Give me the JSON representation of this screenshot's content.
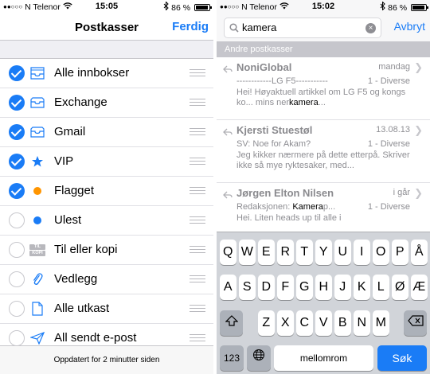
{
  "left": {
    "status": {
      "carrier": "N Telenor",
      "signal_dots": "●●○○○",
      "time": "15:05",
      "battery": "86 %",
      "battery_level": 0.86
    },
    "nav": {
      "title": "Postkasser",
      "done": "Ferdig"
    },
    "mailboxes": [
      {
        "label": "Alle innbokser",
        "checked": true,
        "icon": "tray-stack-icon"
      },
      {
        "label": "Exchange",
        "checked": true,
        "icon": "inbox-tray-icon"
      },
      {
        "label": "Gmail",
        "checked": true,
        "icon": "inbox-tray-icon"
      },
      {
        "label": "VIP",
        "checked": true,
        "icon": "star-icon"
      },
      {
        "label": "Flagget",
        "checked": true,
        "icon": "orange-dot-icon"
      },
      {
        "label": "Ulest",
        "checked": false,
        "icon": "blue-dot-icon"
      },
      {
        "label": "Til eller kopi",
        "checked": false,
        "icon": "to-cc-icon",
        "icon_text_top": "TIL",
        "icon_text_bottom": "KOPI"
      },
      {
        "label": "Vedlegg",
        "checked": false,
        "icon": "paperclip-icon"
      },
      {
        "label": "Alle utkast",
        "checked": false,
        "icon": "document-icon"
      },
      {
        "label": "All sendt e-post",
        "checked": false,
        "icon": "paper-plane-icon"
      }
    ],
    "footer": "Oppdatert for 2 minutter siden"
  },
  "right": {
    "status": {
      "carrier": "N Telenor",
      "signal_dots": "●●○○○",
      "time": "15:02",
      "battery": "86 %",
      "battery_level": 0.86
    },
    "search": {
      "value": "kamera",
      "cancel": "Avbryt"
    },
    "section_header": "Andre postkasser",
    "messages": [
      {
        "sender": "NoniGlobal",
        "date": "mandag",
        "subject": "------------LG F5-----------",
        "folder": "1 - Diverse",
        "preview_before": "Hei! Høyaktuell artikkel om LG F5 og kongs ko... mins ner",
        "preview_match": "kamera",
        "preview_after": "..."
      },
      {
        "sender": "Kjersti Stuestøl",
        "date": "13.08.13",
        "subject": "SV: Noe for Akam?",
        "folder": "1 - Diverse",
        "preview_before": "Jeg kikker nærmere på dette etterpå. Skriver ikke så mye ryktesaker, med...",
        "preview_match": "",
        "preview_after": ""
      },
      {
        "sender": "Jørgen Elton Nilsen",
        "date": "i går",
        "subject_before": "Redaksjonen: ",
        "subject_match": "Kamera",
        "subject_after": "p...",
        "folder": "1 - Diverse",
        "preview_before": "Hei. Liten heads up til alle i",
        "preview_match": "",
        "preview_after": ""
      }
    ],
    "keyboard": {
      "row1": [
        "Q",
        "W",
        "E",
        "R",
        "T",
        "Y",
        "U",
        "I",
        "O",
        "P",
        "Å"
      ],
      "row2": [
        "A",
        "S",
        "D",
        "F",
        "G",
        "H",
        "J",
        "K",
        "L",
        "Ø",
        "Æ"
      ],
      "row3": [
        "Z",
        "X",
        "C",
        "V",
        "B",
        "N",
        "M"
      ],
      "numbers": "123",
      "space": "mellomrom",
      "search": "Søk"
    }
  }
}
